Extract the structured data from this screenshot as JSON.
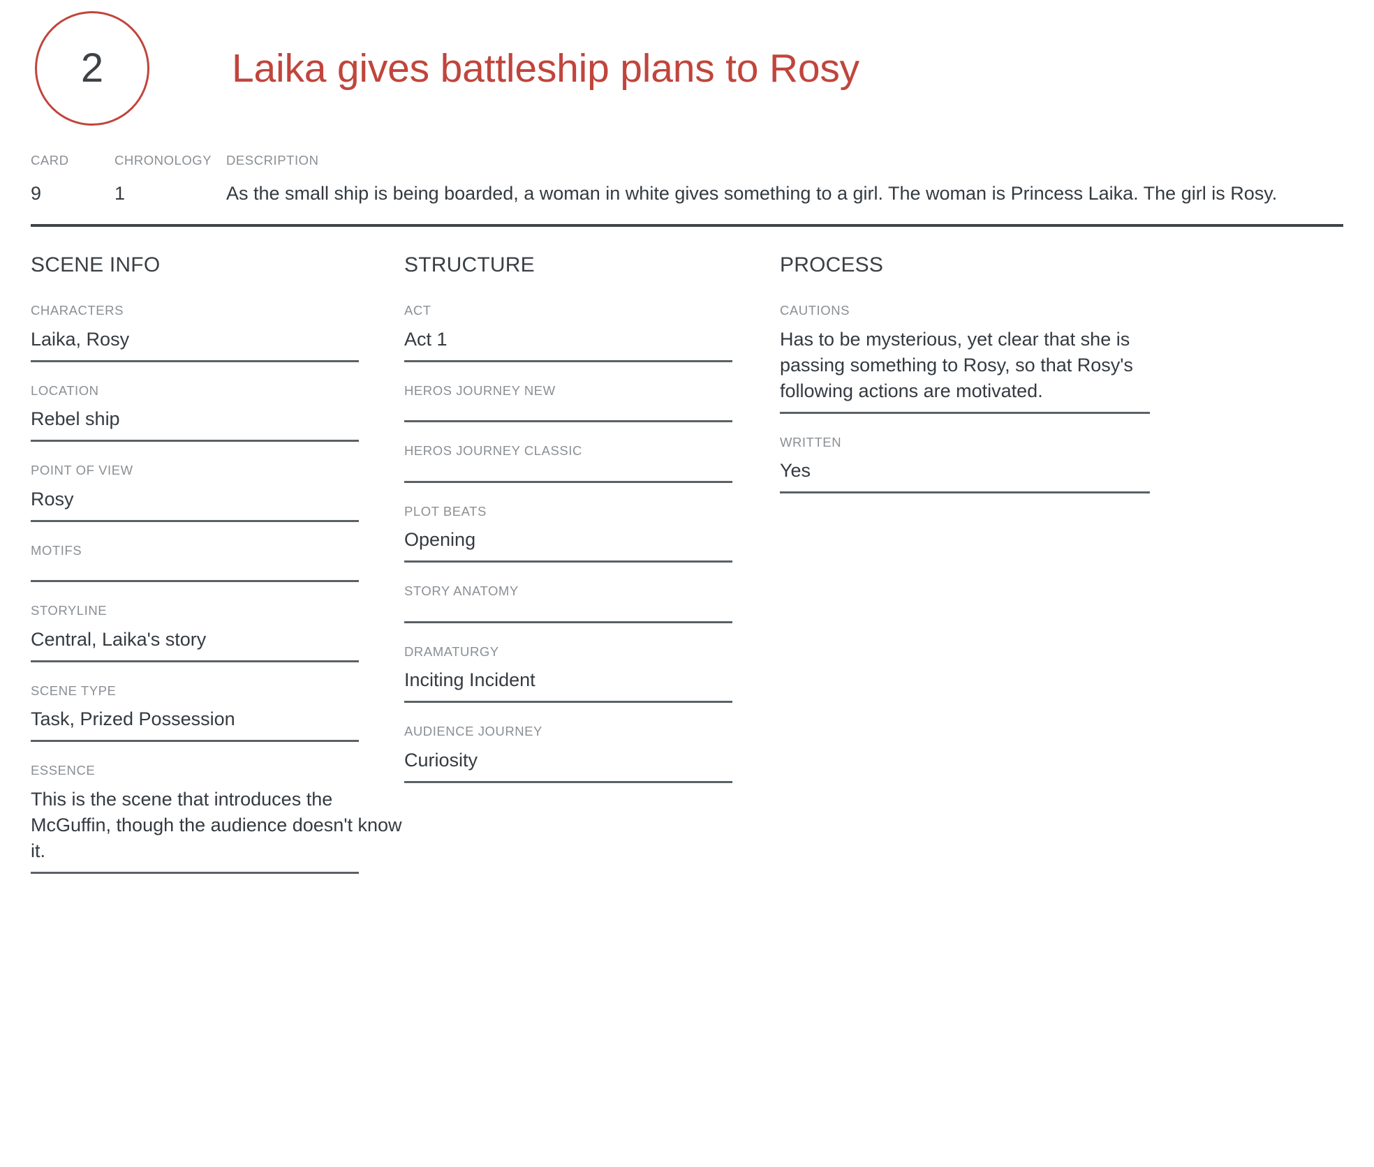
{
  "header": {
    "scene_number": "2",
    "title": "Laika gives battleship plans to Rosy",
    "accent_color": "#c0453c"
  },
  "meta": {
    "card_label": "CARD",
    "card_value": "9",
    "chronology_label": "CHRONOLOGY",
    "chronology_value": "1",
    "description_label": "DESCRIPTION",
    "description_value": "As the small ship is being boarded, a woman in white gives something to a girl. The woman is Princess Laika. The girl is Rosy."
  },
  "columns": {
    "scene_info": {
      "title": "SCENE INFO",
      "fields": [
        {
          "label": "CHARACTERS",
          "value": "Laika, Rosy"
        },
        {
          "label": "LOCATION",
          "value": "Rebel ship"
        },
        {
          "label": "POINT OF VIEW",
          "value": "Rosy"
        },
        {
          "label": "MOTIFS",
          "value": ""
        },
        {
          "label": "STORYLINE",
          "value": "Central, Laika's story"
        },
        {
          "label": "SCENE TYPE",
          "value": "Task, Prized Possession"
        },
        {
          "label": "ESSENCE",
          "value": "This is the scene that introduces the McGuffin, though the audience doesn't know it."
        }
      ]
    },
    "structure": {
      "title": "STRUCTURE",
      "fields": [
        {
          "label": "ACT",
          "value": "Act 1"
        },
        {
          "label": "HEROS JOURNEY NEW",
          "value": ""
        },
        {
          "label": "HEROS JOURNEY CLASSIC",
          "value": ""
        },
        {
          "label": "PLOT BEATS",
          "value": "Opening"
        },
        {
          "label": "STORY ANATOMY",
          "value": ""
        },
        {
          "label": "DRAMATURGY",
          "value": "Inciting Incident"
        },
        {
          "label": "AUDIENCE JOURNEY",
          "value": "Curiosity"
        }
      ]
    },
    "process": {
      "title": "PROCESS",
      "fields": [
        {
          "label": "CAUTIONS",
          "value": "Has to be mysterious, yet clear that she is passing something to Rosy, so that Rosy's following actions are motivated."
        },
        {
          "label": "WRITTEN",
          "value": "Yes"
        }
      ]
    }
  }
}
